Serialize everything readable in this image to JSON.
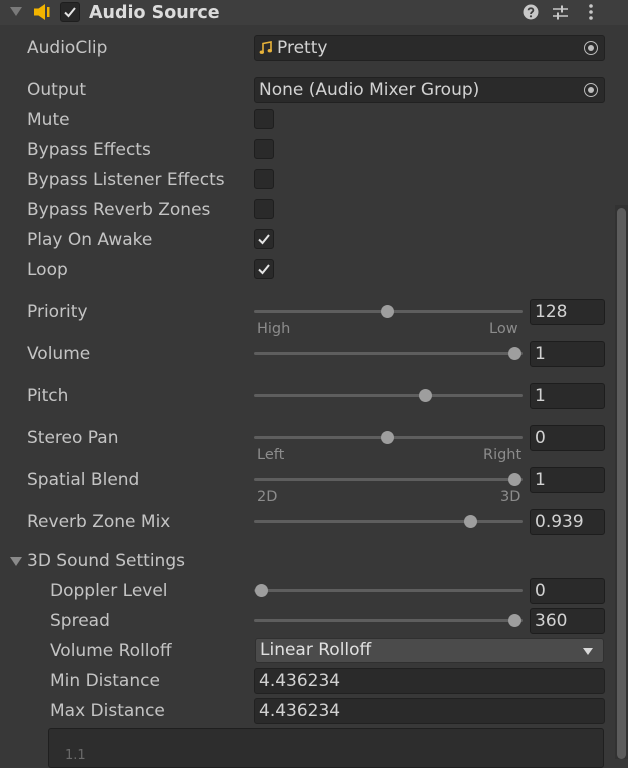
{
  "component": {
    "title": "Audio Source",
    "enabled": true
  },
  "fields": {
    "audio_clip": {
      "label": "AudioClip",
      "value": "Pretty"
    },
    "output": {
      "label": "Output",
      "value": "None (Audio Mixer Group)"
    },
    "mute": {
      "label": "Mute",
      "checked": false
    },
    "bypass_effects": {
      "label": "Bypass Effects",
      "checked": false
    },
    "bypass_listener_effects": {
      "label": "Bypass Listener Effects",
      "checked": false
    },
    "bypass_reverb_zones": {
      "label": "Bypass Reverb Zones",
      "checked": false
    },
    "play_on_awake": {
      "label": "Play On Awake",
      "checked": true
    },
    "loop": {
      "label": "Loop",
      "checked": true
    }
  },
  "sliders": {
    "priority": {
      "label": "Priority",
      "value": "128",
      "fraction": 0.5,
      "min_label": "High",
      "max_label": "Low"
    },
    "volume": {
      "label": "Volume",
      "value": "1",
      "fraction": 1.0
    },
    "pitch": {
      "label": "Pitch",
      "value": "1",
      "fraction": 0.65
    },
    "stereo_pan": {
      "label": "Stereo Pan",
      "value": "0",
      "fraction": 0.5,
      "min_label": "Left",
      "max_label": "Right"
    },
    "spatial_blend": {
      "label": "Spatial Blend",
      "value": "1",
      "fraction": 1.0,
      "min_label": "2D",
      "max_label": "3D"
    },
    "reverb_zone_mix": {
      "label": "Reverb Zone Mix",
      "value": "0.939",
      "fraction": 0.83
    }
  },
  "sound3d": {
    "header": "3D Sound Settings",
    "doppler_level": {
      "label": "Doppler Level",
      "value": "0",
      "fraction": 0.0
    },
    "spread": {
      "label": "Spread",
      "value": "360",
      "fraction": 1.0
    },
    "volume_rolloff": {
      "label": "Volume Rolloff",
      "value": "Linear Rolloff"
    },
    "min_distance": {
      "label": "Min Distance",
      "value": "4.436234"
    },
    "max_distance": {
      "label": "Max Distance",
      "value": "4.436234"
    },
    "curve_tick": "1.1"
  },
  "icons": {
    "foldout": "triangle-down-icon",
    "speaker": "speaker-icon",
    "help": "help-icon",
    "presets": "sliders-icon",
    "menu": "kebab-menu-icon",
    "clip": "music-note-icon",
    "object_picker": "target-icon"
  },
  "colors": {
    "background": "#383838",
    "field": "#2a2a2a",
    "speaker_icon": "#f2b400",
    "clip_icon": "#e8b33a"
  }
}
